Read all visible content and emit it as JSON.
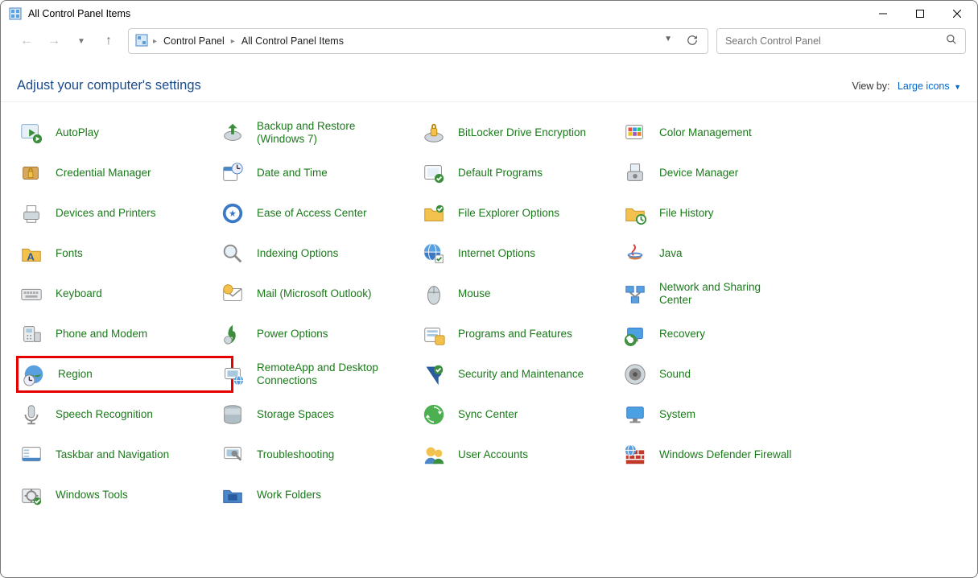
{
  "window": {
    "title": "All Control Panel Items"
  },
  "breadcrumb": {
    "root": "Control Panel",
    "leaf": "All Control Panel Items"
  },
  "search": {
    "placeholder": "Search Control Panel"
  },
  "header": {
    "title": "Adjust your computer's settings",
    "viewby_label": "View by:",
    "viewby_value": "Large icons"
  },
  "items": [
    {
      "label": "AutoPlay",
      "icon": "autoplay-icon"
    },
    {
      "label": "Backup and Restore (Windows 7)",
      "icon": "backup-icon"
    },
    {
      "label": "BitLocker Drive Encryption",
      "icon": "bitlocker-icon"
    },
    {
      "label": "Color Management",
      "icon": "color-icon"
    },
    {
      "label": "Credential Manager",
      "icon": "credential-icon"
    },
    {
      "label": "Date and Time",
      "icon": "datetime-icon"
    },
    {
      "label": "Default Programs",
      "icon": "defaults-icon"
    },
    {
      "label": "Device Manager",
      "icon": "devicemgr-icon"
    },
    {
      "label": "Devices and Printers",
      "icon": "devprint-icon"
    },
    {
      "label": "Ease of Access Center",
      "icon": "ease-icon"
    },
    {
      "label": "File Explorer Options",
      "icon": "folderopts-icon"
    },
    {
      "label": "File History",
      "icon": "filehist-icon"
    },
    {
      "label": "Fonts",
      "icon": "fonts-icon"
    },
    {
      "label": "Indexing Options",
      "icon": "indexing-icon"
    },
    {
      "label": "Internet Options",
      "icon": "inetopts-icon"
    },
    {
      "label": "Java",
      "icon": "java-icon"
    },
    {
      "label": "Keyboard",
      "icon": "keyboard-icon"
    },
    {
      "label": "Mail (Microsoft Outlook)",
      "icon": "mail-icon"
    },
    {
      "label": "Mouse",
      "icon": "mouse-icon"
    },
    {
      "label": "Network and Sharing Center",
      "icon": "network-icon"
    },
    {
      "label": "Phone and Modem",
      "icon": "phone-icon"
    },
    {
      "label": "Power Options",
      "icon": "power-icon"
    },
    {
      "label": "Programs and Features",
      "icon": "programs-icon"
    },
    {
      "label": "Recovery",
      "icon": "recovery-icon"
    },
    {
      "label": "Region",
      "icon": "region-icon",
      "hl": true
    },
    {
      "label": "RemoteApp and Desktop Connections",
      "icon": "remoteapp-icon"
    },
    {
      "label": "Security and Maintenance",
      "icon": "security-icon"
    },
    {
      "label": "Sound",
      "icon": "sound-icon"
    },
    {
      "label": "Speech Recognition",
      "icon": "speech-icon"
    },
    {
      "label": "Storage Spaces",
      "icon": "storage-icon"
    },
    {
      "label": "Sync Center",
      "icon": "sync-icon"
    },
    {
      "label": "System",
      "icon": "system-icon"
    },
    {
      "label": "Taskbar and Navigation",
      "icon": "taskbar-icon"
    },
    {
      "label": "Troubleshooting",
      "icon": "troubleshoot-icon"
    },
    {
      "label": "User Accounts",
      "icon": "users-icon"
    },
    {
      "label": "Windows Defender Firewall",
      "icon": "firewall-icon"
    },
    {
      "label": "Windows Tools",
      "icon": "wintools-icon"
    },
    {
      "label": "Work Folders",
      "icon": "workfolders-icon"
    }
  ]
}
